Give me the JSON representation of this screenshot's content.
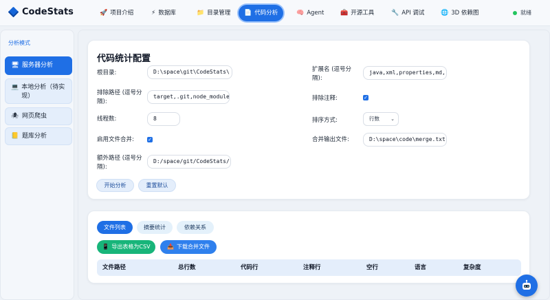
{
  "app": {
    "name": "CodeStats"
  },
  "nav": {
    "items": [
      {
        "label": "项目介绍",
        "icon": "rocket-icon",
        "glyph": "🚀"
      },
      {
        "label": "数据库",
        "icon": "bolt-icon",
        "glyph": "⚡"
      },
      {
        "label": "目录管理",
        "icon": "folder-icon",
        "glyph": "📁"
      },
      {
        "label": "代码分析",
        "icon": "document-icon",
        "glyph": "📄"
      },
      {
        "label": "Agent",
        "icon": "brain-icon",
        "glyph": "🧠"
      },
      {
        "label": "开源工具",
        "icon": "toolbox-icon",
        "glyph": "🧰"
      },
      {
        "label": "API 调试",
        "icon": "tool-icon",
        "glyph": "🔧"
      },
      {
        "label": "3D 依赖图",
        "icon": "globe-icon",
        "glyph": "🌐"
      }
    ],
    "active": "代码分析"
  },
  "status": {
    "label": "就绪",
    "color": "#22c55e"
  },
  "sidebar": {
    "title": "分析模式",
    "items": [
      {
        "label": "服务器分析",
        "icon": "monitor-icon",
        "glyph": "🖥"
      },
      {
        "label": "本地分析（待实现）",
        "icon": "laptop-icon",
        "glyph": "💻"
      },
      {
        "label": "网页爬虫",
        "icon": "spider-icon",
        "glyph": "🕷"
      },
      {
        "label": "题库分析",
        "icon": "book-icon",
        "glyph": "📒"
      }
    ]
  },
  "config": {
    "title": "代码统计配置",
    "root_label": "根目录:",
    "root_value": "D:\\space\\git\\CodeStats\\",
    "exclude_label": "排除路径 (逗号分隔):",
    "exclude_value": "target,.git,node_modules",
    "threads_label": "线程数:",
    "threads_value": "8",
    "merge_label": "启用文件合并:",
    "extra_label": "额外路径 (逗号分隔):",
    "extra_value": "D:/space/git/CodeStats/",
    "ext_label": "扩展名 (逗号分隔):",
    "ext_value": "java,xml,properties,md,",
    "exclude_comments_label": "排除注释:",
    "sort_label": "排序方式:",
    "sort_value": "行数",
    "output_label": "合并输出文件:",
    "output_value": "D:\\space\\code\\merge.txt",
    "start_button": "开始分析",
    "reset_button": "重置默认"
  },
  "results": {
    "tabs": [
      "文件列表",
      "摘要统计",
      "依赖关系"
    ],
    "export_csv": "导出表格为CSV",
    "download_merged": "下载合并文件",
    "columns": [
      "文件路径",
      "总行数",
      "代码行",
      "注释行",
      "空行",
      "语言",
      "复杂度"
    ]
  },
  "colors": {
    "accent": "#1f6fe5",
    "export_green": "#18b57a",
    "download_blue": "#2f80ed"
  }
}
